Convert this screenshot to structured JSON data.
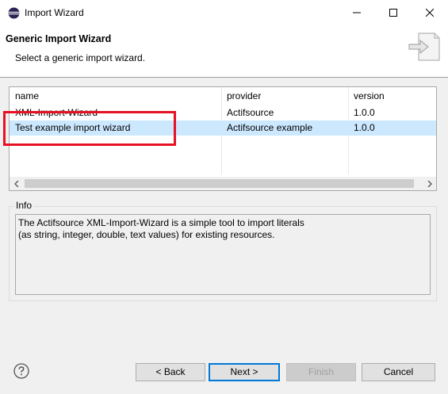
{
  "window": {
    "title": "Import Wizard",
    "icon": "eclipse-icon"
  },
  "header": {
    "title": "Generic Import Wizard",
    "subtitle": "Select a generic import wizard.",
    "icon": "import-arrow-icon"
  },
  "table": {
    "columns": [
      "name",
      "provider",
      "version"
    ],
    "rows": [
      {
        "name": "XML-Import-Wizard",
        "provider": "Actifsource",
        "version": "1.0.0"
      },
      {
        "name": "Test example import wizard",
        "provider": "Actifsource example",
        "version": "1.0.0"
      }
    ],
    "selected_row": 1
  },
  "info": {
    "legend": "Info",
    "text_line1": "The Actifsource XML-Import-Wizard is a simple tool to import literals",
    "text_line2": "(as string, integer, double, text values) for existing resources."
  },
  "buttons": {
    "back": "< Back",
    "next": "Next >",
    "finish": "Finish",
    "cancel": "Cancel"
  },
  "colors": {
    "selection": "#cce8ff",
    "highlight_box": "#e81123",
    "default_button_border": "#0078d7"
  }
}
